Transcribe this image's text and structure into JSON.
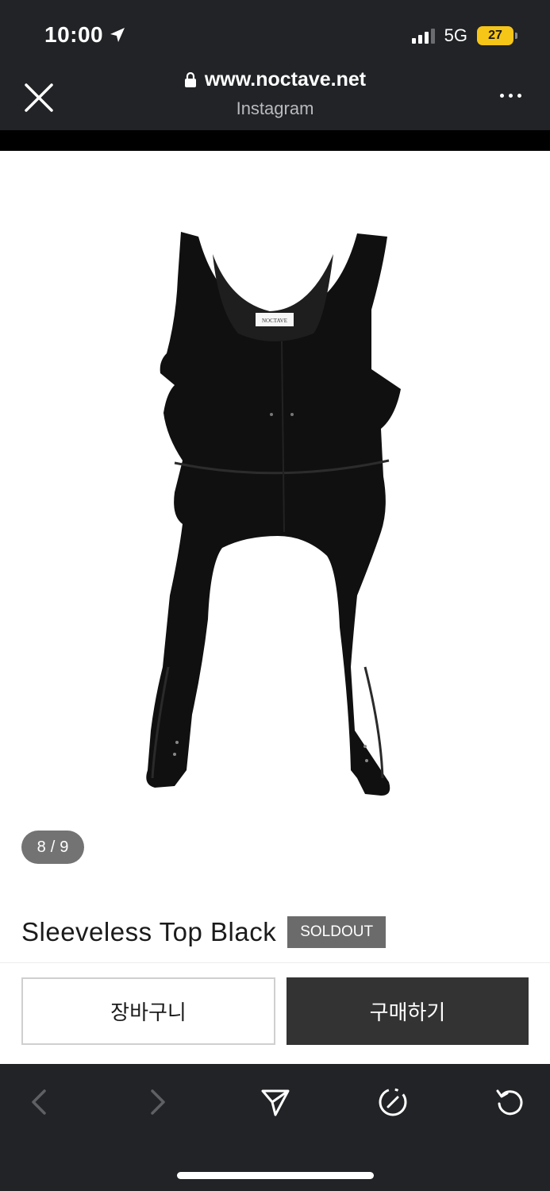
{
  "status_bar": {
    "time": "10:00",
    "network": "5G",
    "battery": "27"
  },
  "browser": {
    "url": "www.noctave.net",
    "source": "Instagram",
    "icons": {
      "close": "close-icon",
      "lock": "lock-icon",
      "more": "more-icon",
      "location": "location-arrow-icon"
    }
  },
  "product": {
    "image_alt": "Black sleeveless top with straps",
    "label_tag": "NOCTAVE",
    "pager": {
      "current": "8",
      "separator": "/",
      "total": "9"
    },
    "title": "Sleeveless Top Black",
    "badge": "SOLDOUT"
  },
  "actions": {
    "cart_label": "장바구니",
    "buy_label": "구매하기"
  },
  "bottom_nav": {
    "icons": [
      "back-icon",
      "forward-icon",
      "share-icon",
      "compass-icon",
      "reload-icon"
    ]
  },
  "colors": {
    "chrome_bg": "#212326",
    "badge_bg": "#6b6b6b",
    "buy_bg": "#333333",
    "battery": "#f5c518"
  }
}
